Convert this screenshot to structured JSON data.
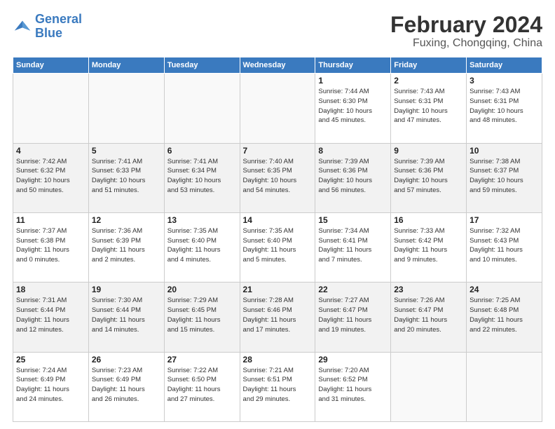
{
  "logo": {
    "line1": "General",
    "line2": "Blue"
  },
  "title": "February 2024",
  "subtitle": "Fuxing, Chongqing, China",
  "days_header": [
    "Sunday",
    "Monday",
    "Tuesday",
    "Wednesday",
    "Thursday",
    "Friday",
    "Saturday"
  ],
  "weeks": [
    [
      {
        "day": "",
        "info": ""
      },
      {
        "day": "",
        "info": ""
      },
      {
        "day": "",
        "info": ""
      },
      {
        "day": "",
        "info": ""
      },
      {
        "day": "1",
        "info": "Sunrise: 7:44 AM\nSunset: 6:30 PM\nDaylight: 10 hours\nand 45 minutes."
      },
      {
        "day": "2",
        "info": "Sunrise: 7:43 AM\nSunset: 6:31 PM\nDaylight: 10 hours\nand 47 minutes."
      },
      {
        "day": "3",
        "info": "Sunrise: 7:43 AM\nSunset: 6:31 PM\nDaylight: 10 hours\nand 48 minutes."
      }
    ],
    [
      {
        "day": "4",
        "info": "Sunrise: 7:42 AM\nSunset: 6:32 PM\nDaylight: 10 hours\nand 50 minutes."
      },
      {
        "day": "5",
        "info": "Sunrise: 7:41 AM\nSunset: 6:33 PM\nDaylight: 10 hours\nand 51 minutes."
      },
      {
        "day": "6",
        "info": "Sunrise: 7:41 AM\nSunset: 6:34 PM\nDaylight: 10 hours\nand 53 minutes."
      },
      {
        "day": "7",
        "info": "Sunrise: 7:40 AM\nSunset: 6:35 PM\nDaylight: 10 hours\nand 54 minutes."
      },
      {
        "day": "8",
        "info": "Sunrise: 7:39 AM\nSunset: 6:36 PM\nDaylight: 10 hours\nand 56 minutes."
      },
      {
        "day": "9",
        "info": "Sunrise: 7:39 AM\nSunset: 6:36 PM\nDaylight: 10 hours\nand 57 minutes."
      },
      {
        "day": "10",
        "info": "Sunrise: 7:38 AM\nSunset: 6:37 PM\nDaylight: 10 hours\nand 59 minutes."
      }
    ],
    [
      {
        "day": "11",
        "info": "Sunrise: 7:37 AM\nSunset: 6:38 PM\nDaylight: 11 hours\nand 0 minutes."
      },
      {
        "day": "12",
        "info": "Sunrise: 7:36 AM\nSunset: 6:39 PM\nDaylight: 11 hours\nand 2 minutes."
      },
      {
        "day": "13",
        "info": "Sunrise: 7:35 AM\nSunset: 6:40 PM\nDaylight: 11 hours\nand 4 minutes."
      },
      {
        "day": "14",
        "info": "Sunrise: 7:35 AM\nSunset: 6:40 PM\nDaylight: 11 hours\nand 5 minutes."
      },
      {
        "day": "15",
        "info": "Sunrise: 7:34 AM\nSunset: 6:41 PM\nDaylight: 11 hours\nand 7 minutes."
      },
      {
        "day": "16",
        "info": "Sunrise: 7:33 AM\nSunset: 6:42 PM\nDaylight: 11 hours\nand 9 minutes."
      },
      {
        "day": "17",
        "info": "Sunrise: 7:32 AM\nSunset: 6:43 PM\nDaylight: 11 hours\nand 10 minutes."
      }
    ],
    [
      {
        "day": "18",
        "info": "Sunrise: 7:31 AM\nSunset: 6:44 PM\nDaylight: 11 hours\nand 12 minutes."
      },
      {
        "day": "19",
        "info": "Sunrise: 7:30 AM\nSunset: 6:44 PM\nDaylight: 11 hours\nand 14 minutes."
      },
      {
        "day": "20",
        "info": "Sunrise: 7:29 AM\nSunset: 6:45 PM\nDaylight: 11 hours\nand 15 minutes."
      },
      {
        "day": "21",
        "info": "Sunrise: 7:28 AM\nSunset: 6:46 PM\nDaylight: 11 hours\nand 17 minutes."
      },
      {
        "day": "22",
        "info": "Sunrise: 7:27 AM\nSunset: 6:47 PM\nDaylight: 11 hours\nand 19 minutes."
      },
      {
        "day": "23",
        "info": "Sunrise: 7:26 AM\nSunset: 6:47 PM\nDaylight: 11 hours\nand 20 minutes."
      },
      {
        "day": "24",
        "info": "Sunrise: 7:25 AM\nSunset: 6:48 PM\nDaylight: 11 hours\nand 22 minutes."
      }
    ],
    [
      {
        "day": "25",
        "info": "Sunrise: 7:24 AM\nSunset: 6:49 PM\nDaylight: 11 hours\nand 24 minutes."
      },
      {
        "day": "26",
        "info": "Sunrise: 7:23 AM\nSunset: 6:49 PM\nDaylight: 11 hours\nand 26 minutes."
      },
      {
        "day": "27",
        "info": "Sunrise: 7:22 AM\nSunset: 6:50 PM\nDaylight: 11 hours\nand 27 minutes."
      },
      {
        "day": "28",
        "info": "Sunrise: 7:21 AM\nSunset: 6:51 PM\nDaylight: 11 hours\nand 29 minutes."
      },
      {
        "day": "29",
        "info": "Sunrise: 7:20 AM\nSunset: 6:52 PM\nDaylight: 11 hours\nand 31 minutes."
      },
      {
        "day": "",
        "info": ""
      },
      {
        "day": "",
        "info": ""
      }
    ]
  ]
}
